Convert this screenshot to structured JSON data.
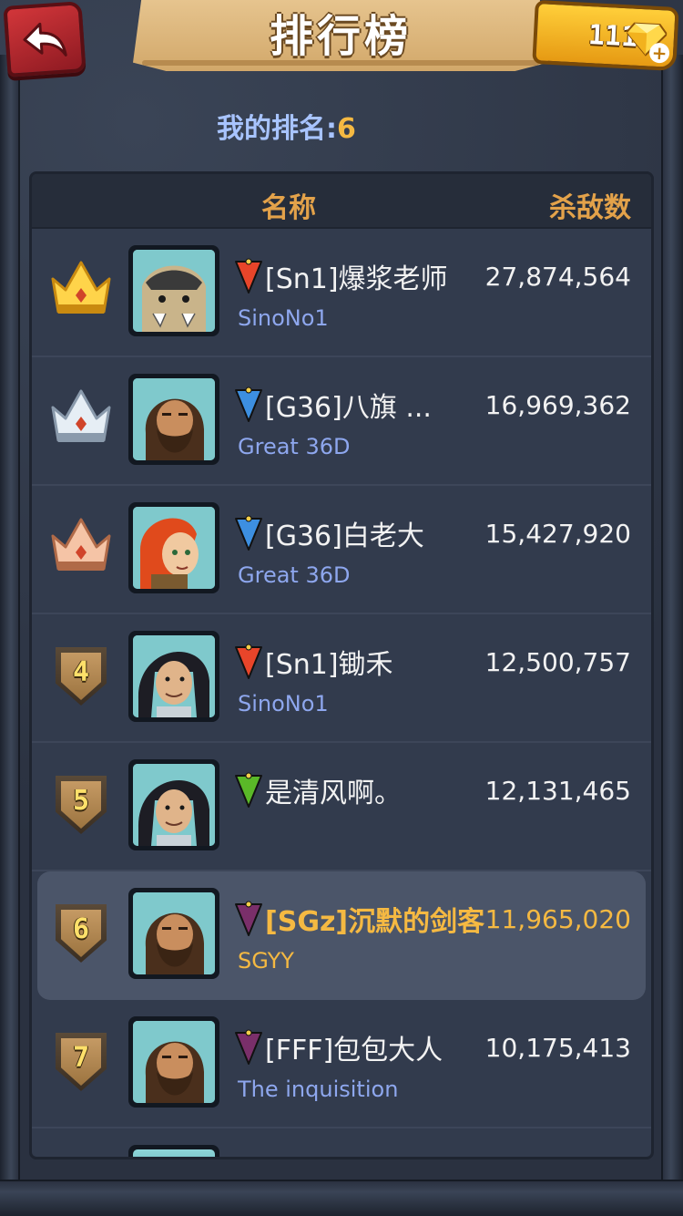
{
  "header": {
    "title": "排行榜",
    "gems": "1119",
    "back_icon": "back-arrow-icon",
    "gem_icon": "diamond-icon"
  },
  "my_rank": {
    "label": "我的排名:",
    "value": "6"
  },
  "table": {
    "col_name": "名称",
    "col_kills": "杀敌数"
  },
  "rows": [
    {
      "rank": "1",
      "badge": "gold-crown",
      "flag_color": "#e8452a",
      "name": "[Sn1]爆浆老师",
      "guild": "SinoNo1",
      "kills": "27,874,564",
      "avatar": "armored-beast"
    },
    {
      "rank": "2",
      "badge": "silver-crown",
      "flag_color": "#3d8fe0",
      "name": "[G36]八旗 ...",
      "guild": "Great 36D",
      "kills": "16,969,362",
      "avatar": "bearded-warrior"
    },
    {
      "rank": "3",
      "badge": "bronze-crown",
      "flag_color": "#3d8fe0",
      "name": "[G36]白老大",
      "guild": "Great 36D",
      "kills": "15,427,920",
      "avatar": "red-haired-woman"
    },
    {
      "rank": "4",
      "badge": "shield",
      "flag_color": "#e8452a",
      "name": "[Sn1]锄禾",
      "guild": "SinoNo1",
      "kills": "12,500,757",
      "avatar": "dark-haired-hero"
    },
    {
      "rank": "5",
      "badge": "shield",
      "flag_color": "#5ab828",
      "name": "是清风啊。",
      "guild": "",
      "kills": "12,131,465",
      "avatar": "dark-haired-hero"
    },
    {
      "rank": "6",
      "badge": "shield",
      "flag_color": "#7a2f6a",
      "name": "[SGz]沉默的剑客",
      "guild": "SGYY",
      "kills": "11,965,020",
      "avatar": "bearded-warrior",
      "highlight": true
    },
    {
      "rank": "7",
      "badge": "shield",
      "flag_color": "#7a2f6a",
      "name": "[FFF]包包大人",
      "guild": "The inquisition",
      "kills": "10,175,413",
      "avatar": "bearded-warrior"
    }
  ]
}
